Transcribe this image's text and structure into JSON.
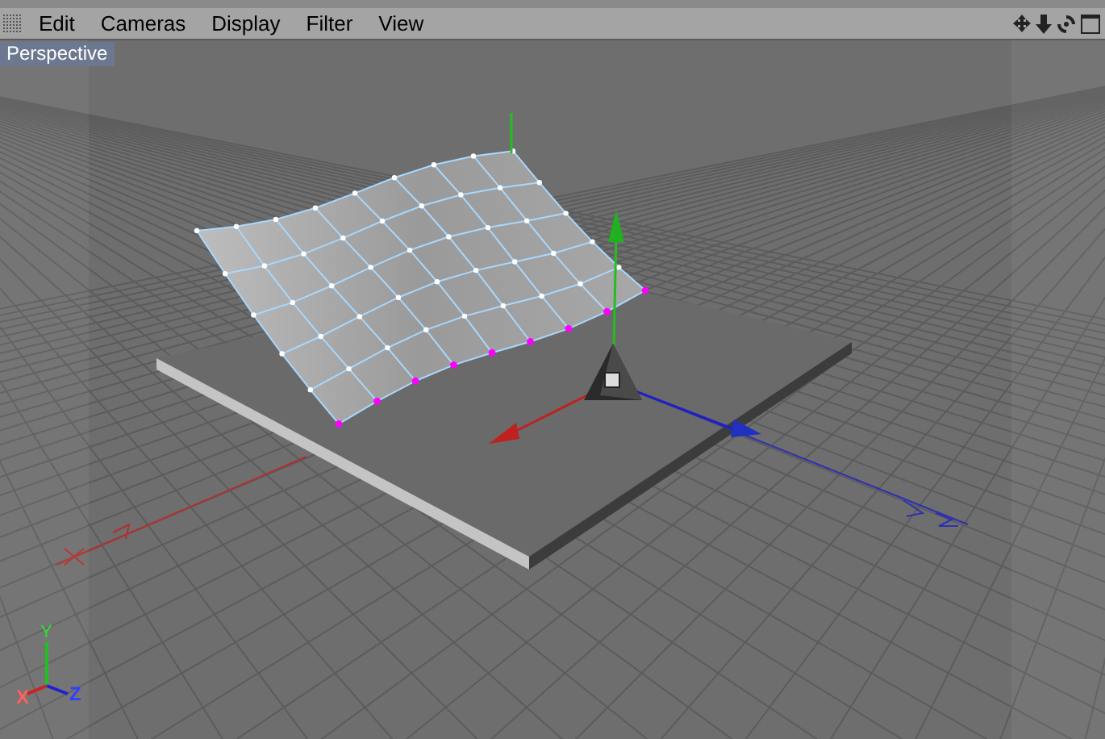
{
  "menu": [
    "Edit",
    "Cameras",
    "Display",
    "Filter",
    "View"
  ],
  "viewport": {
    "label": "Perspective"
  },
  "axis_labels": {
    "x": "X",
    "y": "Y",
    "z": "Z"
  }
}
